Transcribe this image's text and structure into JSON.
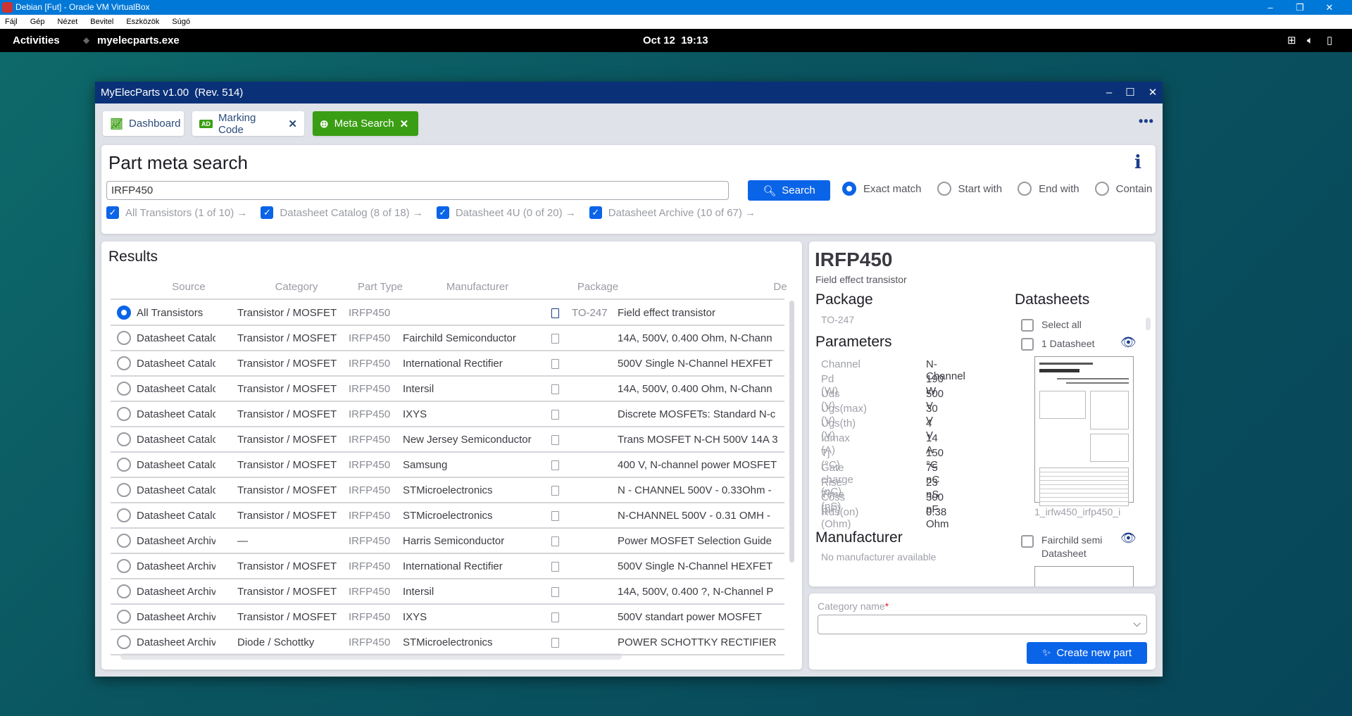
{
  "vbox": {
    "title": "Debian [Fut] - Oracle VM VirtualBox",
    "menu": [
      "Fájl",
      "Gép",
      "Nézet",
      "Bevitel",
      "Eszközök",
      "Súgó"
    ]
  },
  "gnome": {
    "activities": "Activities",
    "app": "myelecparts.exe",
    "clock": "Oct 12  19:13"
  },
  "window": {
    "title": "MyElecParts v1.00  (Rev. 514)"
  },
  "tabs": [
    {
      "label": "Dashboard",
      "icon": "chart-line-icon"
    },
    {
      "label": "Marking Code",
      "icon": "ad-badge-icon",
      "closable": true
    },
    {
      "label": "Meta Search",
      "icon": "search-plus-icon",
      "closable": true,
      "active": true
    }
  ],
  "search": {
    "title": "Part meta search",
    "query": "IRFP450",
    "button": "Search",
    "modes": [
      {
        "label": "Exact match",
        "selected": true
      },
      {
        "label": "Start with"
      },
      {
        "label": "End with"
      },
      {
        "label": "Contain"
      }
    ],
    "sources": [
      {
        "label": "All Transistors (1 of 10) →",
        "checked": true
      },
      {
        "label": "Datasheet Catalog (8 of 18) →",
        "checked": true
      },
      {
        "label": "Datasheet 4U (0 of 20) →",
        "checked": true
      },
      {
        "label": "Datasheet Archive (10 of 67) →",
        "checked": true
      }
    ]
  },
  "results": {
    "title": "Results",
    "columns": [
      "Source",
      "Category",
      "Part Type",
      "Manufacturer",
      "Package",
      "De"
    ],
    "rows": [
      [
        "All Transistors",
        "Transistor / MOSFET",
        "IRFP450",
        "",
        "TO-247",
        "Field effect transistor"
      ],
      [
        "Datasheet Catalog",
        "Transistor / MOSFET",
        "IRFP450",
        "Fairchild Semiconductor",
        "",
        "14A, 500V, 0.400 Ohm, N-Chann"
      ],
      [
        "Datasheet Catalog",
        "Transistor / MOSFET",
        "IRFP450",
        "International Rectifier",
        "",
        "500V Single N-Channel HEXFET"
      ],
      [
        "Datasheet Catalog",
        "Transistor / MOSFET",
        "IRFP450",
        "Intersil",
        "",
        "14A, 500V, 0.400 Ohm, N-Chann"
      ],
      [
        "Datasheet Catalog",
        "Transistor / MOSFET",
        "IRFP450",
        "IXYS",
        "",
        "Discrete MOSFETs: Standard N-c"
      ],
      [
        "Datasheet Catalog",
        "Transistor / MOSFET",
        "IRFP450",
        "New Jersey Semiconductor",
        "",
        "Trans MOSFET N-CH 500V 14A 3"
      ],
      [
        "Datasheet Catalog",
        "Transistor / MOSFET",
        "IRFP450",
        "Samsung",
        "",
        "400 V, N-channel power MOSFET"
      ],
      [
        "Datasheet Catalog",
        "Transistor / MOSFET",
        "IRFP450",
        "STMicroelectronics",
        "",
        "N - CHANNEL 500V - 0.33Ohm -"
      ],
      [
        "Datasheet Catalog",
        "Transistor / MOSFET",
        "IRFP450",
        "STMicroelectronics",
        "",
        "N-CHANNEL 500V -  0.31 OMH -"
      ],
      [
        "Datasheet Archive",
        "—",
        "IRFP450",
        "Harris Semiconductor",
        "",
        "Power MOSFET Selection Guide"
      ],
      [
        "Datasheet Archive",
        "Transistor / MOSFET",
        "IRFP450",
        "International Rectifier",
        "",
        "500V Single N-Channel HEXFET"
      ],
      [
        "Datasheet Archive",
        "Transistor / MOSFET",
        "IRFP450",
        "Intersil",
        "",
        "14A, 500V, 0.400 ?, N-Channel P"
      ],
      [
        "Datasheet Archive",
        "Transistor / MOSFET",
        "IRFP450",
        "IXYS",
        "",
        "500V standart power MOSFET"
      ],
      [
        "Datasheet Archive",
        "Diode / Schottky",
        "IRFP450",
        "STMicroelectronics",
        "",
        "POWER SCHOTTKY RECTIFIER"
      ]
    ],
    "selected_row": 0
  },
  "detail": {
    "part": "IRFP450",
    "description": "Field effect transistor",
    "package_heading": "Package",
    "package": "TO-247",
    "parameters_heading": "Parameters",
    "parameters": [
      [
        "Channel",
        "N-Channel"
      ],
      [
        "Pd (W)",
        "190 W"
      ],
      [
        "Uds (V)",
        "500 V"
      ],
      [
        "Ugs(max) (V)",
        "30 V"
      ],
      [
        "Ugs(th) (V)",
        "4 V"
      ],
      [
        "Idmax (A)",
        "14 A"
      ],
      [
        "Tj (°C)",
        "150 °C"
      ],
      [
        "Gate charge (nC)",
        "75 nC"
      ],
      [
        "Rise Time (nS)",
        "23 nS"
      ],
      [
        "Coss (pF)",
        "300 pF"
      ],
      [
        "Rds(on) (Ohm)",
        "0.38 Ohm"
      ]
    ],
    "manufacturer_heading": "Manufacturer",
    "manufacturer": "No manufacturer available",
    "datasheets_heading": "Datasheets",
    "select_all": "Select all",
    "datasheets": [
      {
        "label": "1 Datasheet",
        "file": "1_irfw450_irfp450_i"
      },
      {
        "label": "Fairchild semi",
        "label2": "Datasheet"
      }
    ]
  },
  "create": {
    "category_label": "Category name",
    "required": "*",
    "category_value": "",
    "button": "Create new part"
  },
  "colors": {
    "accent": "#0a64e8",
    "active_tab": "#3a9e14",
    "title_bar": "#0a3178"
  }
}
